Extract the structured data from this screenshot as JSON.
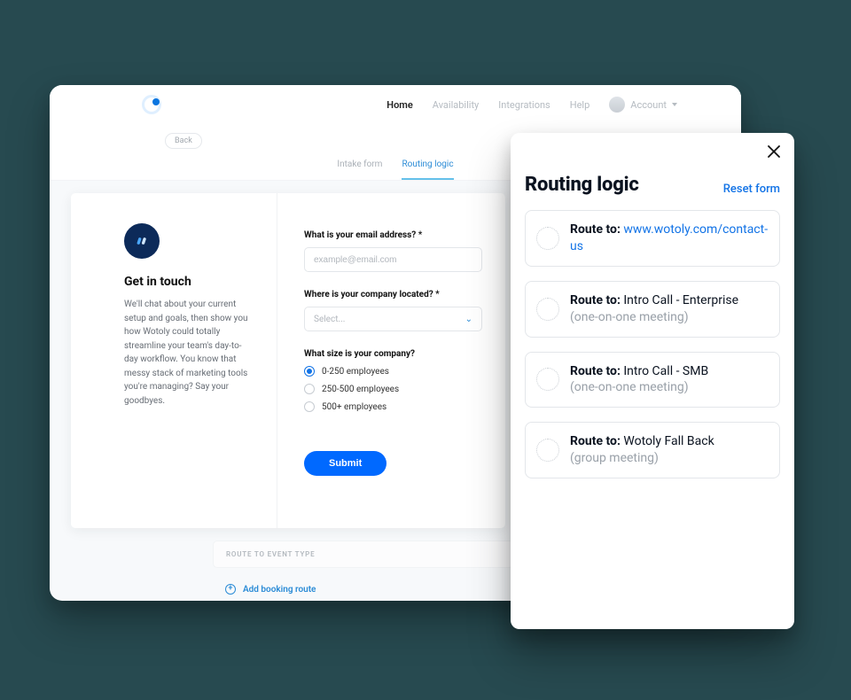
{
  "nav": {
    "items": [
      "Home",
      "Availability",
      "Integrations",
      "Help"
    ],
    "account_label": "Account"
  },
  "subheader": {
    "back_label": "Back",
    "tabs": [
      "Intake form",
      "Routing logic"
    ]
  },
  "intro": {
    "title": "Get in touch",
    "body": "We'll chat about your current setup and goals, then show you how Wotoly could totally streamline your team's day-to-day workflow. You know that messy stack of marketing tools you're managing? Say your goodbyes."
  },
  "form": {
    "email_label": "What is your email address? *",
    "email_placeholder": "example@email.com",
    "location_label": "Where is your company located? *",
    "location_placeholder": "Select...",
    "size_label": "What size is your company?",
    "size_options": [
      "0-250 employees",
      "250-500 employees",
      "500+ employees"
    ],
    "submit_label": "Submit"
  },
  "below": {
    "caption": "ROUTE TO EVENT TYPE",
    "add_route_label": "Add booking route"
  },
  "panel": {
    "title": "Routing logic",
    "reset_label": "Reset form",
    "route_to_label": "Route to:",
    "routes": [
      {
        "destination": "www.wotoly.com/contact-us",
        "is_link": true,
        "sub": ""
      },
      {
        "destination": "Intro Call - Enterprise",
        "is_link": false,
        "sub": "(one-on-one meeting)"
      },
      {
        "destination": "Intro Call - SMB",
        "is_link": false,
        "sub": "(one-on-one meeting)"
      },
      {
        "destination": "Wotoly Fall Back",
        "is_link": false,
        "sub": "(group meeting)"
      }
    ]
  }
}
